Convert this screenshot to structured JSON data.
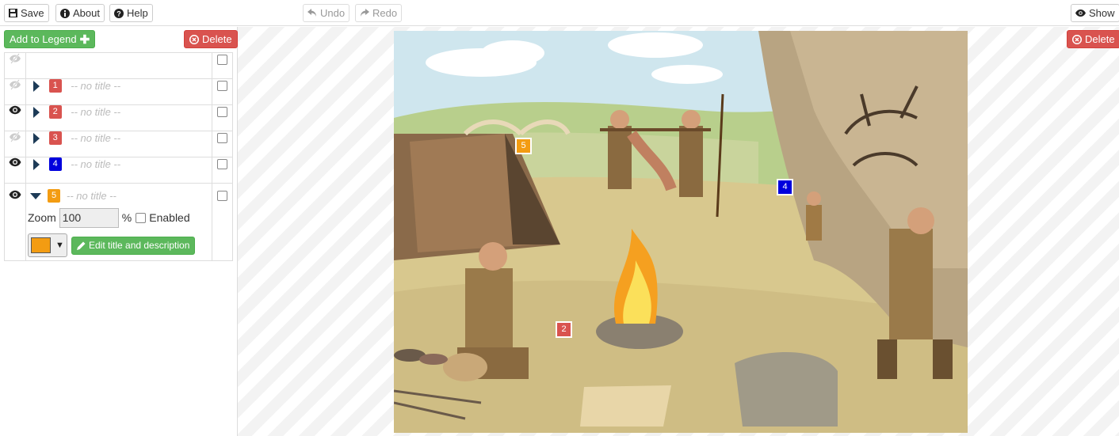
{
  "toolbar": {
    "save": "Save",
    "about": "About",
    "help": "Help",
    "undo": "Undo",
    "redo": "Redo",
    "show": "Show"
  },
  "sidebar": {
    "add_to_legend": "Add to Legend",
    "delete": "Delete",
    "items": [
      {
        "number": "1",
        "title": "-- no title --",
        "color": "#d9534f",
        "visible": false
      },
      {
        "number": "2",
        "title": "-- no title --",
        "color": "#d9534f",
        "visible": true
      },
      {
        "number": "3",
        "title": "-- no title --",
        "color": "#d9534f",
        "visible": false
      },
      {
        "number": "4",
        "title": "-- no title --",
        "color": "#0000dd",
        "visible": true
      },
      {
        "number": "5",
        "title": "-- no title --",
        "color": "#f39c12",
        "visible": true,
        "expanded": true
      }
    ],
    "detail": {
      "zoom_label": "Zoom",
      "zoom_value": "100",
      "percent": "%",
      "enabled_label": "Enabled",
      "swatch_color": "#f39c12",
      "caret": "▼",
      "edit_button": "Edit title and description"
    }
  },
  "canvas": {
    "delete": "Delete",
    "markers": [
      {
        "number": "5",
        "color": "#f39c12"
      },
      {
        "number": "4",
        "color": "#0000dd"
      },
      {
        "number": "2",
        "color": "#d9534f"
      }
    ]
  }
}
